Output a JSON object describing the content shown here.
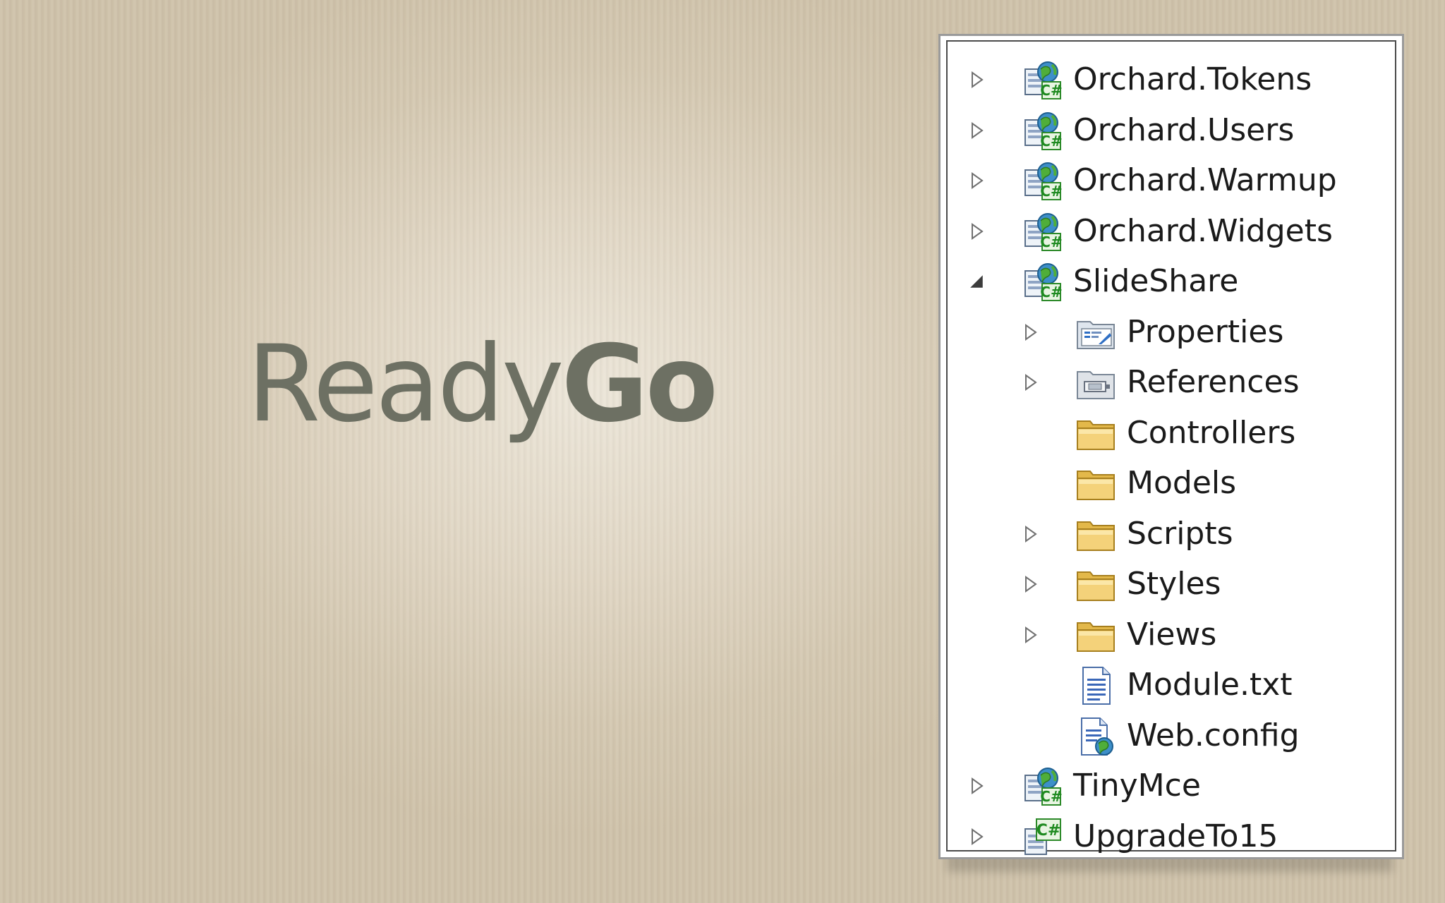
{
  "logo": {
    "part1": "Ready",
    "part2": "Go"
  },
  "tree": [
    {
      "label": "Orchard.Tokens",
      "depth": 0,
      "expander": "collapsed",
      "icon": "csharp-web-project-icon"
    },
    {
      "label": "Orchard.Users",
      "depth": 0,
      "expander": "collapsed",
      "icon": "csharp-web-project-icon"
    },
    {
      "label": "Orchard.Warmup",
      "depth": 0,
      "expander": "collapsed",
      "icon": "csharp-web-project-icon"
    },
    {
      "label": "Orchard.Widgets",
      "depth": 0,
      "expander": "collapsed",
      "icon": "csharp-web-project-icon"
    },
    {
      "label": "SlideShare",
      "depth": 0,
      "expander": "expanded",
      "icon": "csharp-web-project-icon"
    },
    {
      "label": "Properties",
      "depth": 1,
      "expander": "collapsed",
      "icon": "properties-icon"
    },
    {
      "label": "References",
      "depth": 1,
      "expander": "collapsed",
      "icon": "references-icon"
    },
    {
      "label": "Controllers",
      "depth": 1,
      "expander": "none",
      "icon": "folder-icon"
    },
    {
      "label": "Models",
      "depth": 1,
      "expander": "none",
      "icon": "folder-icon"
    },
    {
      "label": "Scripts",
      "depth": 1,
      "expander": "collapsed",
      "icon": "folder-icon"
    },
    {
      "label": "Styles",
      "depth": 1,
      "expander": "collapsed",
      "icon": "folder-icon"
    },
    {
      "label": "Views",
      "depth": 1,
      "expander": "collapsed",
      "icon": "folder-icon"
    },
    {
      "label": "Module.txt",
      "depth": 1,
      "expander": "none",
      "icon": "text-file-icon"
    },
    {
      "label": "Web.config",
      "depth": 1,
      "expander": "none",
      "icon": "config-file-icon"
    },
    {
      "label": "TinyMce",
      "depth": 0,
      "expander": "collapsed",
      "icon": "csharp-web-project-icon"
    },
    {
      "label": "UpgradeTo15",
      "depth": 0,
      "expander": "collapsed",
      "icon": "csharp-project-icon"
    }
  ]
}
